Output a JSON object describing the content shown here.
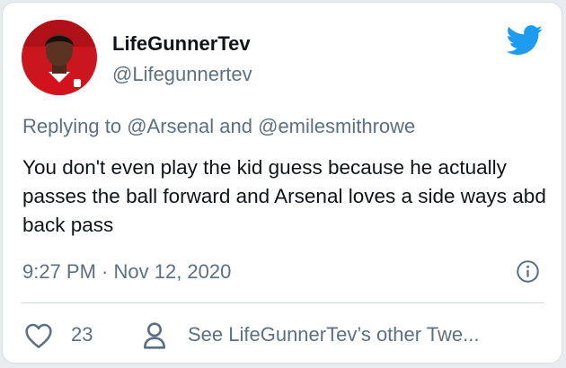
{
  "tweet": {
    "author_name": "LifeGunnerTev",
    "author_handle": "@Lifegunnertev",
    "replying_prefix": "Replying to",
    "reply_mention_1": "@Arsenal",
    "reply_and": "and",
    "reply_mention_2": "@emilesmithrowe",
    "text": "You don't even play the kid guess because he actually passes the ball forward and Arsenal loves a side ways abd back pass",
    "timestamp": "9:27 PM · Nov 12, 2020",
    "like_count": "23",
    "see_more_label": "See LifeGunnerTev’s other Twe..."
  },
  "icons": {
    "brand": "twitter-bird-icon",
    "info": "info-icon",
    "like": "heart-icon",
    "profile": "person-icon"
  },
  "colors": {
    "twitter_blue": "#1d9bf0",
    "text_primary": "#0f1419",
    "text_secondary": "#5b7083",
    "avatar_shirt": "#d2121d"
  }
}
